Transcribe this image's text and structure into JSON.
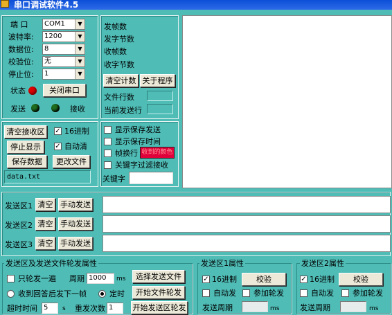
{
  "window": {
    "title": "串口调试软件4.5"
  },
  "port": {
    "port_label": "端  口",
    "port_value": "COM1",
    "baud_label": "波特率:",
    "baud_value": "1200",
    "databits_label": "数据位:",
    "databits_value": "8",
    "parity_label": "校验位:",
    "parity_value": "无",
    "stopbits_label": "停止位:",
    "stopbits_value": "1",
    "status_label": "状态",
    "close_button": "关闭串口",
    "send_label": "发送",
    "recv_label": "接收",
    "status_color": "#e00000",
    "send_led_color": "#1e6e1e",
    "recv_led_color": "#1e6e1e"
  },
  "stats": {
    "sent_frames": "发帧数",
    "sent_bytes": "发字节数",
    "recv_frames": "收帧数",
    "recv_bytes": "收字节数",
    "clear_count": "清空计数",
    "about": "关于程序",
    "file_lines": "文件行数",
    "current_line": "当前发送行"
  },
  "recv_controls": {
    "clear_recv": "清空接收区",
    "hex16": "16进制",
    "hex16_checked": "✓",
    "stop_display": "停止显示",
    "auto_clear": "自动清",
    "auto_clear_checked": "✓",
    "save_data": "保存数据",
    "change_file": "更改文件",
    "filename": "data.txt"
  },
  "display_opts": {
    "show_saved_send": "显示保存发送",
    "show_save_time": "显示保存时间",
    "frame_newline": "帧换行",
    "recv_color_label": "收到的颜色",
    "keyword_filter": "关键字过滤接收",
    "keyword": "关键字",
    "recv_color": "#e0003a"
  },
  "send_areas": [
    {
      "label": "发送区1",
      "clear": "清空",
      "manual": "手动发送"
    },
    {
      "label": "发送区2",
      "clear": "清空",
      "manual": "手动发送"
    },
    {
      "label": "发送区3",
      "clear": "清空",
      "manual": "手动发送"
    }
  ],
  "poll": {
    "title": "发送区及发送文件轮发属性",
    "once": "只轮发一遍",
    "period": "周期",
    "period_value": "1000",
    "ms": "ms",
    "choose_file": "选择发送文件",
    "reply_next": "收到回答后发下一帧",
    "timed": "定时",
    "start_file_poll": "开始文件轮发",
    "timeout": "超时时间",
    "timeout_value": "5",
    "s": "s",
    "retries": "重发次数",
    "retries_value": "1",
    "start_area_poll": "开始发送区轮发"
  },
  "area1_props": {
    "title": "发送区1属性",
    "hex16": "16进制",
    "checksum": "校验",
    "auto_send": "自动发",
    "join_poll": "参加轮发",
    "period": "发送周期",
    "ms": "ms"
  },
  "area2_props": {
    "title": "发送区2属性",
    "hex16": "16进制",
    "checksum": "校验",
    "auto_send": "自动发",
    "join_poll": "参加轮发",
    "period": "发送周期",
    "ms": "ms"
  }
}
